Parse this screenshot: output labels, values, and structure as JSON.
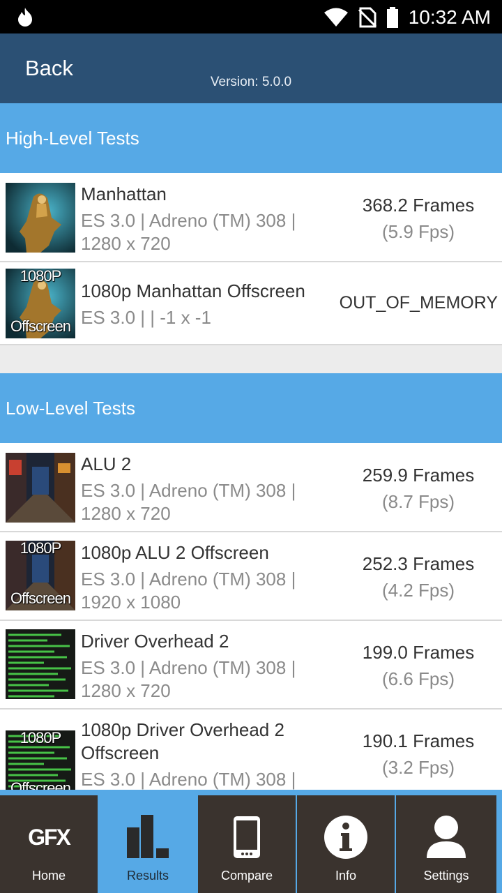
{
  "status": {
    "time": "10:32 AM"
  },
  "header": {
    "back_label": "Back",
    "version": "Version: 5.0.0"
  },
  "sections": [
    {
      "title": "High-Level Tests",
      "items": [
        {
          "name": "Manhattan",
          "detail": "ES 3.0 | Adreno (TM) 308 | 1280 x 720",
          "frames": "368.2 Frames",
          "fps": "(5.9 Fps)",
          "thumb_text": ""
        },
        {
          "name": "1080p Manhattan Offscreen",
          "detail": "ES 3.0 |  | -1 x -1",
          "error": "OUT_OF_MEMORY",
          "thumb_text_top": "1080P",
          "thumb_text_bottom": "Offscreen"
        }
      ]
    },
    {
      "title": "Low-Level Tests",
      "items": [
        {
          "name": "ALU 2",
          "detail": "ES 3.0 | Adreno (TM) 308 | 1280 x 720",
          "frames": "259.9 Frames",
          "fps": "(8.7 Fps)"
        },
        {
          "name": "1080p ALU 2 Offscreen",
          "detail": "ES 3.0 | Adreno (TM) 308 | 1920 x 1080",
          "frames": "252.3 Frames",
          "fps": "(4.2 Fps)",
          "thumb_text_top": "1080P",
          "thumb_text_bottom": "Offscreen"
        },
        {
          "name": "Driver Overhead 2",
          "detail": "ES 3.0 | Adreno (TM) 308 | 1280 x 720",
          "frames": "199.0 Frames",
          "fps": "(6.6 Fps)"
        },
        {
          "name": "1080p Driver Overhead 2 Offscreen",
          "detail": "ES 3.0 | Adreno (TM) 308 |",
          "frames": "190.1 Frames",
          "fps": "(3.2 Fps)",
          "thumb_text_top": "1080P",
          "thumb_text_bottom": "Offscreen"
        }
      ]
    }
  ],
  "nav": {
    "logo_text": "GFX",
    "tabs": [
      {
        "label": "Home"
      },
      {
        "label": "Results"
      },
      {
        "label": "Compare"
      },
      {
        "label": "Info"
      },
      {
        "label": "Settings"
      }
    ],
    "active": "Results"
  },
  "colors": {
    "accent": "#56a9e6",
    "appbar": "#2b5074",
    "nav_bg": "#3a332e"
  }
}
